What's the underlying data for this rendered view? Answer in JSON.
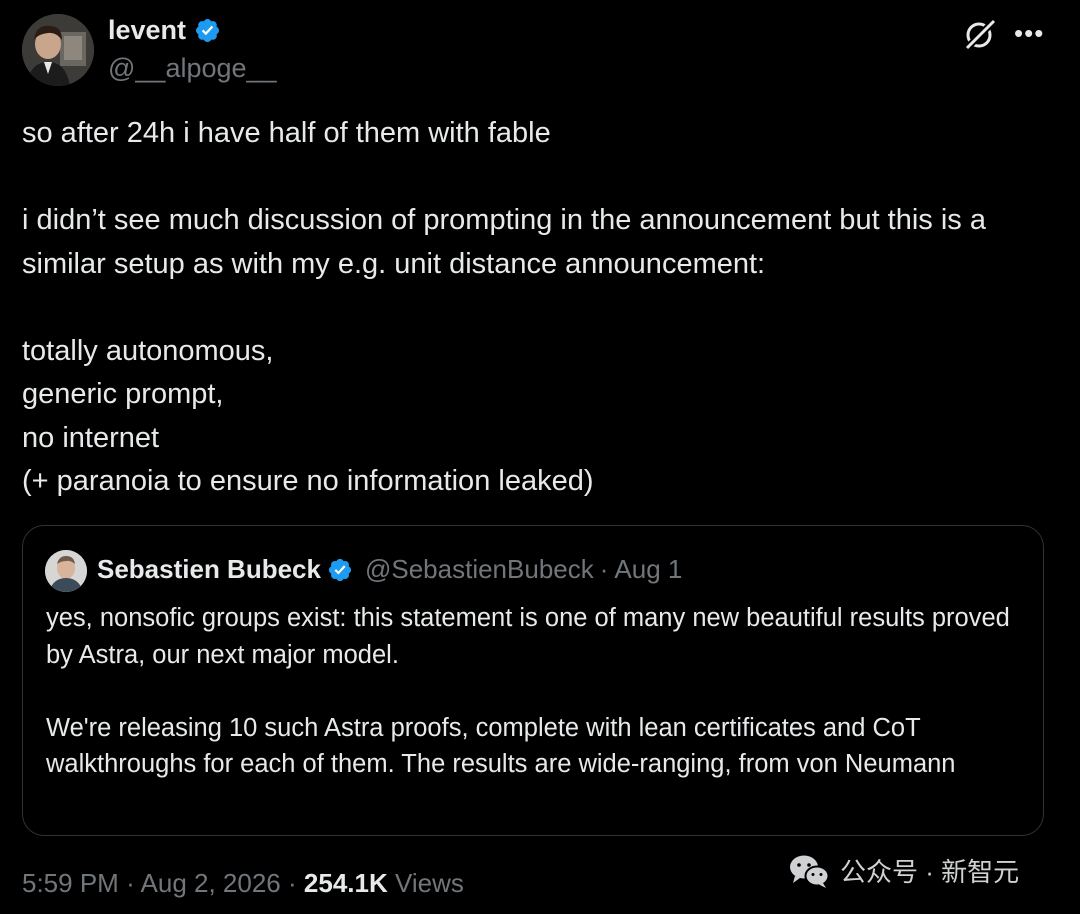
{
  "author": {
    "name": "levent",
    "handle": "@__alpoge__"
  },
  "tweet": {
    "paragraphs": [
      "so after 24h i have half of them with fable",
      "i didn’t see much discussion of prompting in the announcement but this is a similar setup as with my e.g. unit distance announcement:",
      [
        "totally autonomous,",
        "generic prompt,",
        "no internet",
        "(+ paranoia to ensure no information leaked)"
      ]
    ]
  },
  "quote": {
    "name": "Sebastien Bubeck",
    "handle": "@SebastienBubeck",
    "separator": "·",
    "date": "Aug 1",
    "paragraph1": "yes, nonsofic groups exist: this statement is one of many new beautiful results proved by Astra, our next major model.",
    "paragraph2": "We're releasing 10 such Astra proofs, complete with lean certificates and CoT walkthroughs for each of them. The results are wide-ranging, from von Neumann"
  },
  "meta": {
    "time": "5:59 PM",
    "separator": "·",
    "date": "Aug 2, 2026",
    "separator2": "·",
    "views_count": "254.1K",
    "views_label": "Views"
  },
  "watermark": {
    "text": "公众号 · 新智元"
  },
  "colors": {
    "background": "#000000",
    "text": "#e7e9ea",
    "secondary": "#71767b",
    "verified": "#1d9bf0",
    "border": "#2f3336"
  },
  "icons": [
    "verified-badge-icon",
    "grok-icon",
    "more-icon",
    "wechat-icon"
  ]
}
